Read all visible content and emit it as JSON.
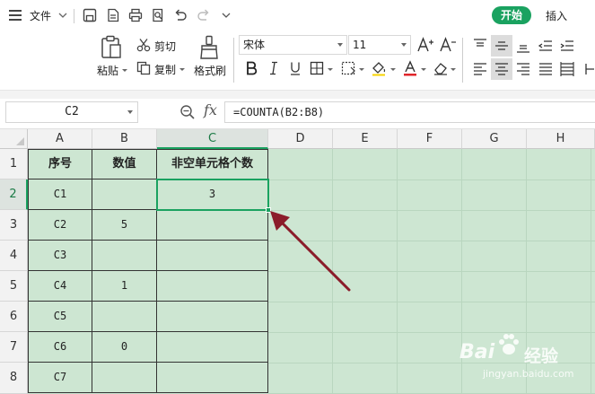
{
  "menu": {
    "file_label": "文件",
    "tabs": [
      "开始",
      "插入"
    ],
    "active_tab": "开始"
  },
  "ribbon": {
    "paste_label": "粘贴",
    "cut_label": "剪切",
    "copy_label": "复制",
    "format_painter_label": "格式刷",
    "font_name": "宋体",
    "font_size": "11"
  },
  "formula_bar": {
    "cell_ref": "C2",
    "fx_label": "fx",
    "formula": "=COUNTA(B2:B8)"
  },
  "sheet": {
    "columns": [
      "A",
      "B",
      "C",
      "D",
      "E",
      "F",
      "G",
      "H"
    ],
    "rows": [
      "1",
      "2",
      "3",
      "4",
      "5",
      "6",
      "7",
      "8"
    ],
    "active_cell": "C2",
    "table": [
      [
        "序号",
        "数值",
        "非空单元格个数"
      ],
      [
        "C1",
        "",
        "3"
      ],
      [
        "C2",
        "5",
        ""
      ],
      [
        "C3",
        "",
        ""
      ],
      [
        "C4",
        "1",
        ""
      ],
      [
        "C5",
        "",
        ""
      ],
      [
        "C6",
        "0",
        ""
      ],
      [
        "C7",
        "",
        ""
      ]
    ]
  },
  "watermark": {
    "brand": "Bai",
    "brand_cn": "经验",
    "url": "jingyan.baidu.com"
  },
  "colors": {
    "accent": "#1aa260",
    "sheet_bg": "#cde6d2",
    "arrow": "#8b1c2a"
  }
}
